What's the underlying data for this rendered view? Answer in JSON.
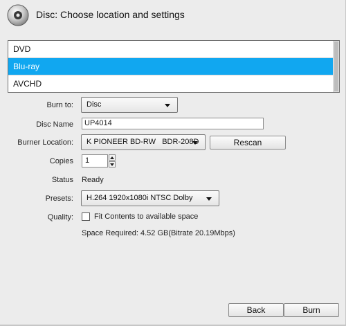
{
  "title": "Disc: Choose location and settings",
  "formats": [
    {
      "label": "DVD",
      "selected": false
    },
    {
      "label": "Blu-ray",
      "selected": true
    },
    {
      "label": "AVCHD",
      "selected": false
    }
  ],
  "form": {
    "burn_to": {
      "label": "Burn to:",
      "value": "Disc"
    },
    "disc_name": {
      "label": "Disc Name",
      "value": "UP4014"
    },
    "burner_location": {
      "label": "Burner Location:",
      "value": "K PIONEER BD-RW   BDR-208D"
    },
    "rescan_label": "Rescan",
    "copies": {
      "label": "Copies",
      "value": "1"
    },
    "status": {
      "label": "Status",
      "value": "Ready"
    },
    "presets": {
      "label": "Presets:",
      "value": "H.264 1920x1080i NTSC Dolby"
    },
    "quality": {
      "label": "Quality:",
      "checkbox_label": "Fit Contents to available space",
      "checked": false
    },
    "space_required": "Space Required: 4.52 GB(Bitrate 20.19Mbps)"
  },
  "buttons": {
    "back": "Back",
    "burn": "Burn"
  },
  "colors": {
    "selection": "#11a7f0",
    "background": "#ececec"
  }
}
